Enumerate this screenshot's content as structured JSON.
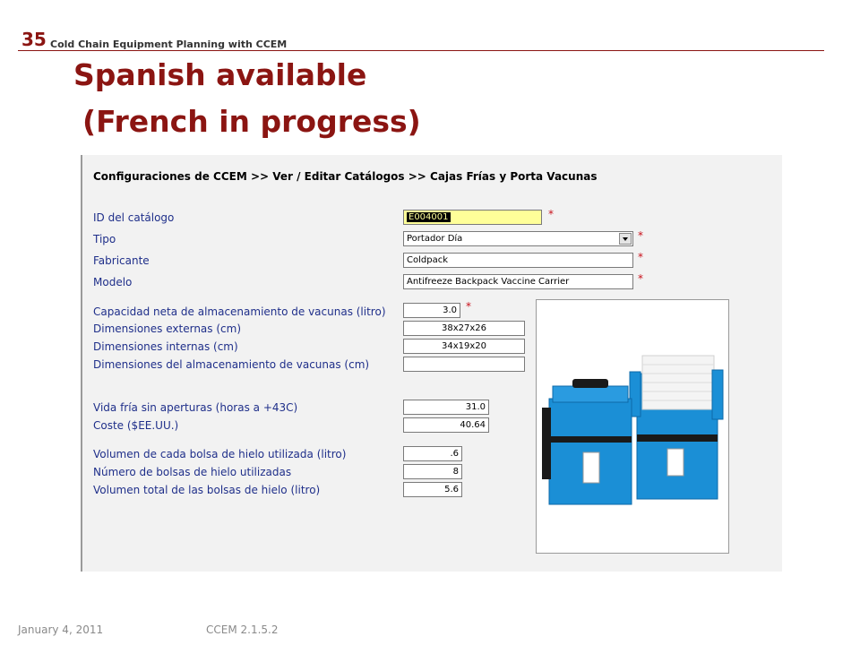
{
  "slide": {
    "number": "35",
    "header": "Cold Chain Equipment Planning with CCEM",
    "title_line1": "Spanish available",
    "title_line2": "(French in progress)"
  },
  "app": {
    "breadcrumb": "Configuraciones de CCEM >> Ver / Editar Catálogos >> Cajas Frías y Porta Vacunas",
    "required_mark": "*",
    "fields": {
      "catalog_id": {
        "label": "ID del catálogo",
        "value": "E004001"
      },
      "type": {
        "label": "Tipo",
        "value": "Portador Día"
      },
      "manufacturer": {
        "label": "Fabricante",
        "value": "Coldpack"
      },
      "model": {
        "label": "Modelo",
        "value": "Antifreeze Backpack Vaccine Carrier"
      },
      "net_capacity": {
        "label": "Capacidad neta de almacenamiento de vacunas (litro)",
        "value": "3.0"
      },
      "external_dims": {
        "label": "Dimensiones externas (cm)",
        "value": "38x27x26"
      },
      "internal_dims": {
        "label": "Dimensiones internas (cm)",
        "value": "34x19x20"
      },
      "storage_dims": {
        "label": "Dimensiones del almacenamiento de vacunas (cm)",
        "value": ""
      },
      "cold_life": {
        "label": "Vida fría sin aperturas (horas a +43C)",
        "value": "31.0"
      },
      "cost": {
        "label": "Coste ($EE.UU.)",
        "value": "40.64"
      },
      "ice_pack_volume": {
        "label": "Volumen de cada bolsa de hielo utilizada (litro)",
        "value": ".6"
      },
      "ice_pack_count": {
        "label": "Número de bolsas de hielo utilizadas",
        "value": "8"
      },
      "ice_pack_total": {
        "label": "Volumen total de las bolsas de hielo (litro)",
        "value": "5.6"
      }
    },
    "image": {
      "name": "product-photo"
    }
  },
  "footer": {
    "date": "January 4, 2011",
    "version": "CCEM 2.1.5.2"
  },
  "colors": {
    "title": "#8b1512",
    "label": "#1f2f8a",
    "required": "#c8101a",
    "highlight": "#ffff99",
    "panel": "#f2f2f2",
    "carrier_blue": "#1b8fd6"
  }
}
